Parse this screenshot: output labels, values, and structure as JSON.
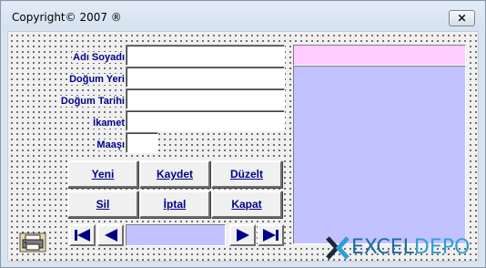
{
  "window": {
    "title": "Copyright© 2007 ®",
    "close_glyph": "✕"
  },
  "form": {
    "labels": {
      "name": "Adı Soyadı",
      "birthplace": "Doğum Yeri",
      "birthdate": "Doğum Tarihi",
      "residence": "İkamet",
      "salary": "Maaşı"
    },
    "values": {
      "name": "",
      "birthplace": "",
      "birthdate": "",
      "residence": "",
      "salary": ""
    }
  },
  "buttons": {
    "new": "Yeni",
    "save": "Kaydet",
    "edit": "Düzelt",
    "delete": "Sil",
    "cancel": "İptal",
    "close": "Kapat"
  },
  "navigation": {
    "icons": [
      "first-record-icon",
      "previous-record-icon",
      "next-record-icon",
      "last-record-icon"
    ],
    "record_text": ""
  },
  "colors": {
    "label": "#00008b",
    "pink_field": "#ffccff",
    "list_box": "#c2c2ff"
  },
  "logo": {
    "text_a": "EXCEL",
    "text_b": "DEPO"
  }
}
